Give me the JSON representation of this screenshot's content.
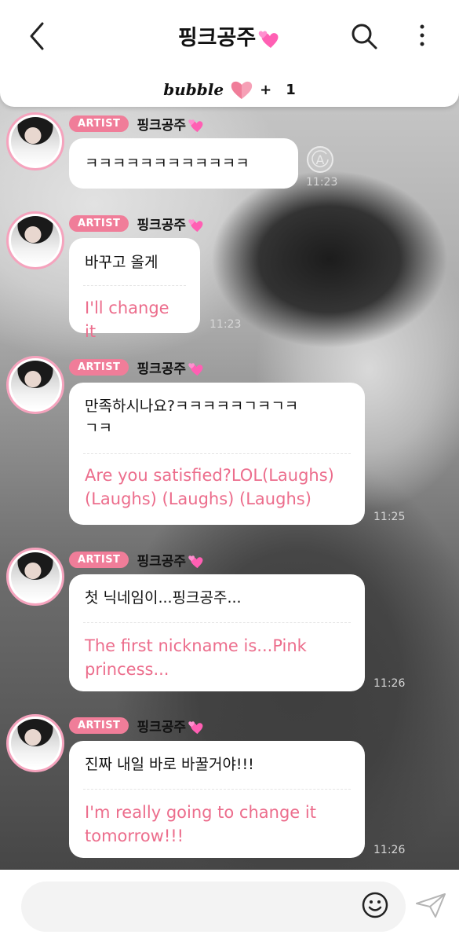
{
  "header": {
    "title": "핑크공주",
    "bubble_label": "bubble",
    "bubble_plus": "+",
    "bubble_count": "1",
    "icons": [
      "back-arrow-icon",
      "search-icon",
      "more-vertical-icon",
      "heart-icon"
    ]
  },
  "messages": [
    {
      "badge": "ARTIST",
      "sender": "핑크공주",
      "ko": "ㅋㅋㅋㅋㅋㅋㅋㅋㅋㅋㅋㅋ",
      "en": "",
      "time": "11:23"
    },
    {
      "badge": "ARTIST",
      "sender": "핑크공주",
      "ko": "바꾸고 올게",
      "en": "I'll change it",
      "time": "11:23"
    },
    {
      "badge": "ARTIST",
      "sender": "핑크공주",
      "ko_line1": "만족하시나요?ㅋㅋㅋㅋㅋㄱㅋㄱㅋ",
      "ko_line2": "ㄱㅋ",
      "en_line1": "Are you satisfied?LOL(Laughs)",
      "en_line2": "(Laughs) (Laughs) (Laughs)",
      "time": "11:25"
    },
    {
      "badge": "ARTIST",
      "sender": "핑크공주",
      "ko": "첫 닉네임이...핑크공주...",
      "en_line1": "The first nickname is...Pink",
      "en_line2": "princess...",
      "time": "11:26"
    },
    {
      "badge": "ARTIST",
      "sender": "핑크공주",
      "ko": "진짜 내일 바로 바꿀거야!!!",
      "en_line1": "I'm really going to change it",
      "en_line2": "tomorrow!!!",
      "time": "11:26"
    }
  ],
  "colors": {
    "accent_pink": "#ec6d8c",
    "badge_pink": "#f07d99",
    "avatar_ring": "#f5a3bd"
  },
  "input": {
    "icons": [
      "emoji-icon",
      "send-icon"
    ]
  }
}
